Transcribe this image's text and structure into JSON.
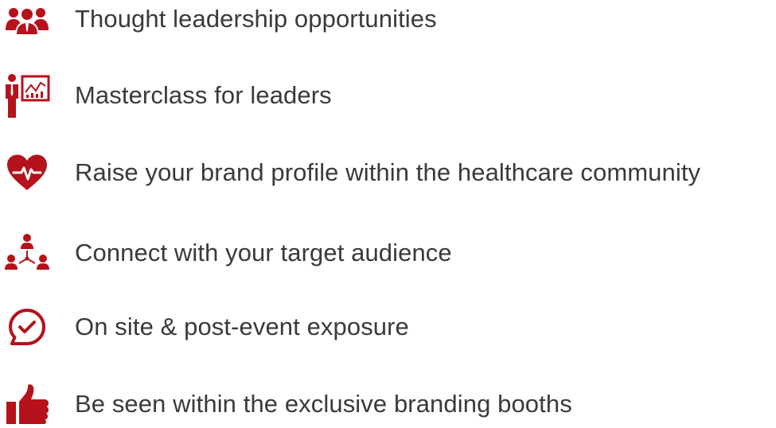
{
  "accent_color": "#b5121b",
  "text_color": "#3a3a3a",
  "items": [
    {
      "label": "Thought leadership opportunities",
      "icon": "group-people-icon"
    },
    {
      "label": "Masterclass for leaders",
      "icon": "presenter-chart-icon"
    },
    {
      "label": "Raise your brand profile within the healthcare community",
      "icon": "heart-pulse-icon"
    },
    {
      "label": "Connect with your target audience",
      "icon": "network-people-icon"
    },
    {
      "label": "On site & post-event exposure",
      "icon": "check-speech-bubble-icon"
    },
    {
      "label": "Be seen within the exclusive branding booths",
      "icon": "thumbs-up-icon"
    }
  ]
}
